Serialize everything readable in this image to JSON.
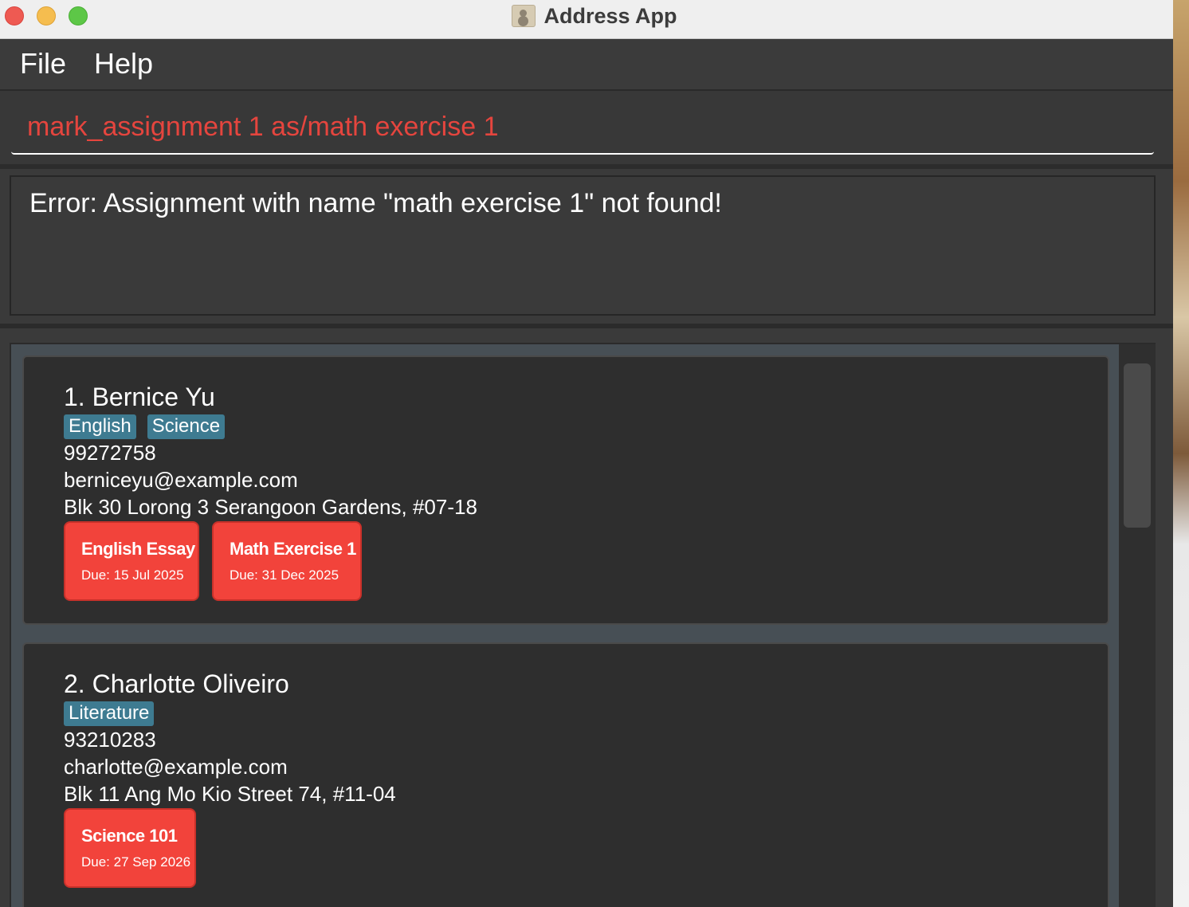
{
  "window": {
    "title": "Address App"
  },
  "menu": {
    "items": [
      {
        "label": "File"
      },
      {
        "label": "Help"
      }
    ]
  },
  "command": {
    "value": "mark_assignment 1 as/math exercise 1"
  },
  "result": {
    "message": "Error: Assignment with name \"math exercise 1\" not found!"
  },
  "persons": [
    {
      "name": "1. Bernice Yu",
      "tags": [
        "English",
        "Science"
      ],
      "phone": "99272758",
      "email": "berniceyu@example.com",
      "address": "Blk 30 Lorong 3 Serangoon Gardens, #07-18",
      "assignments": [
        {
          "name": "English Essay",
          "due": "Due: 15 Jul 2025"
        },
        {
          "name": "Math Exercise 1",
          "due": "Due: 31 Dec 2025"
        }
      ]
    },
    {
      "name": "2. Charlotte Oliveiro",
      "tags": [
        "Literature"
      ],
      "phone": "93210283",
      "email": "charlotte@example.com",
      "address": "Blk 11 Ang Mo Kio Street 74, #11-04",
      "assignments": [
        {
          "name": "Science 101",
          "due": "Due: 27 Sep 2026"
        }
      ]
    }
  ],
  "colors": {
    "command_error_text": "#e5453e",
    "tag_bg": "#3e7b91",
    "assignment_bg": "#f2433b"
  },
  "icons": {
    "app_icon": "address-book-icon"
  }
}
